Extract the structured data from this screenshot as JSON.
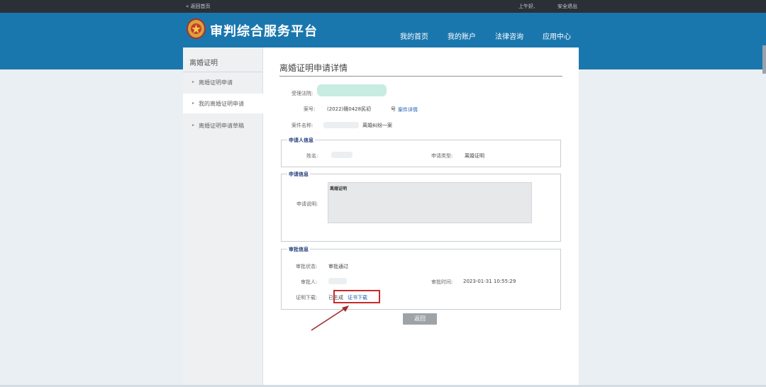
{
  "topbar": {
    "back_link": "« 返回首页",
    "greeting": "上午好,",
    "logout": "安全退出"
  },
  "header": {
    "site_title": "审判综合服务平台",
    "nav": [
      "我的首页",
      "我的账户",
      "法律咨询",
      "应用中心"
    ]
  },
  "sidebar": {
    "title": "离婚证明",
    "items": [
      {
        "label": "离婚证明申请"
      },
      {
        "label": "我的离婚证明申请"
      },
      {
        "label": "离婚证明申请草稿"
      }
    ]
  },
  "main": {
    "page_title": "离婚证明申请详情",
    "handling_court_label": "受理法院:",
    "case_no_label": "案号:",
    "case_no_value": "(2022)赣0428民初",
    "case_no_suffix": "号",
    "case_detail_link": "案件详情",
    "case_name_label": "案件名称:",
    "case_name_value": "离婚纠纷一案",
    "applicant": {
      "section_title": "申请人信息",
      "name_label": "姓名:",
      "type_label": "申请类型:",
      "type_value": "离婚证明"
    },
    "application": {
      "section_title": "申请信息",
      "desc_label": "申请说明:",
      "desc_value": "离婚证明"
    },
    "review": {
      "section_title": "审批信息",
      "status_label": "审批状态:",
      "status_value": "审批通过",
      "reviewer_label": "审批人:",
      "time_label": "审批时间:",
      "time_value": "2023-01-31 10:55:29",
      "download_label": "证明下载:",
      "download_status": "已生成",
      "download_link": "证书下载"
    },
    "back_button": "返回"
  }
}
